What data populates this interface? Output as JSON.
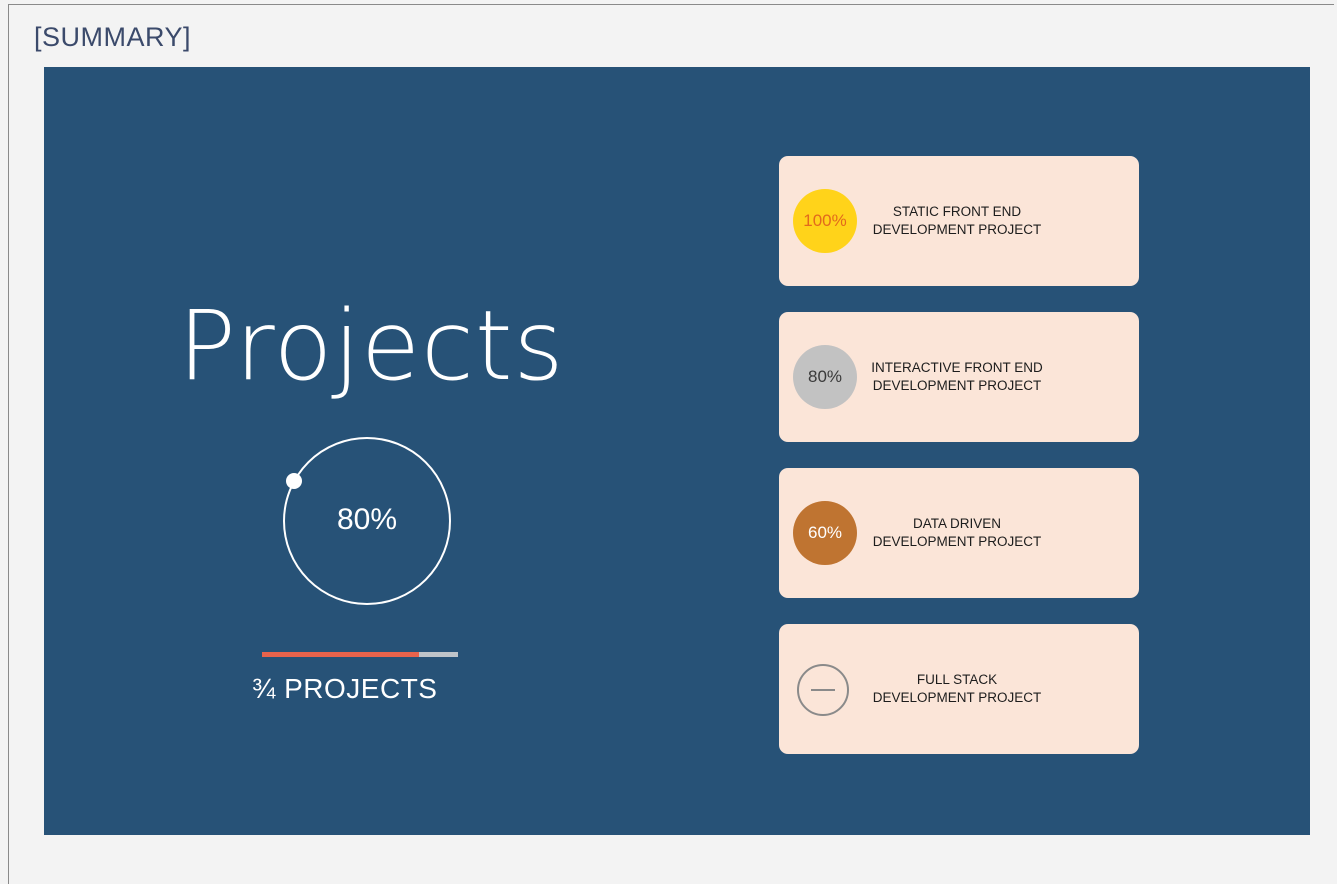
{
  "header": {
    "title": "[SUMMARY]"
  },
  "main": {
    "title": "Projects",
    "overall_progress": {
      "percent_label": "80%",
      "percent": 80
    },
    "projects_bar": {
      "label": "¾ PROJECTS",
      "fraction": 0.8
    }
  },
  "cards": [
    {
      "badge": "100%",
      "title": "STATIC  FRONT END\nDEVELOPMENT PROJECT",
      "badge_color": "#ffd31a",
      "badge_text_color": "#e26a1c"
    },
    {
      "badge": "80%",
      "title": "INTERACTIVE  FRONT END\nDEVELOPMENT PROJECT",
      "badge_color": "#c2c2c2",
      "badge_text_color": "#3a3a3a"
    },
    {
      "badge": "60%",
      "title": "DATA DRIVEN\nDEVELOPMENT  PROJECT",
      "badge_color": "#bf7431",
      "badge_text_color": "#ffffff"
    },
    {
      "badge": "",
      "title": "FULL STACK\nDEVELOPMENT PROJECT",
      "badge_icon": "minus-circle-icon"
    }
  ],
  "colors": {
    "panel": "#275277",
    "card": "#fbe5d8",
    "bar_fill": "#e8634c",
    "bar_track": "#bfc4c9"
  }
}
